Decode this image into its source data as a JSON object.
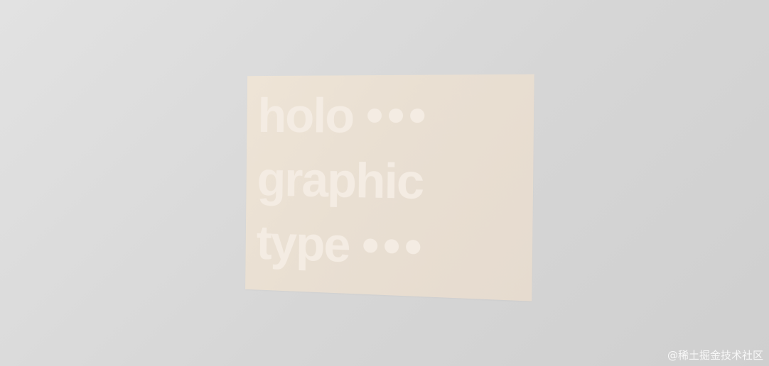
{
  "card": {
    "lines": [
      "holo",
      "graphic",
      "type"
    ]
  },
  "watermark": "@稀土掘金技术社区",
  "colors": {
    "background": "#d8d8d8",
    "card": "#e9dfd2",
    "text": "#f4ece3"
  }
}
